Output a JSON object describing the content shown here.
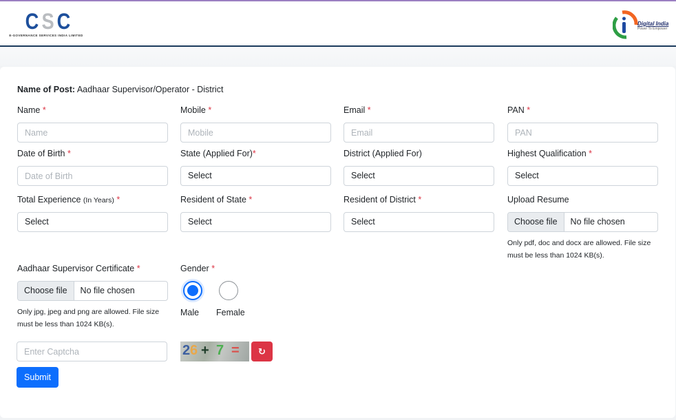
{
  "header": {
    "csc_logo": {
      "letters": [
        "C",
        "S",
        "C"
      ],
      "subtitle": "E-GOVERNANCE SERVICES INDIA LIMITED"
    },
    "digital_india_logo": {
      "title": "Digital India",
      "tagline": "Power To Empower"
    }
  },
  "form": {
    "post_label": "Name of Post:",
    "post_value": "Aadhaar Supervisor/Operator - District",
    "required_mark": "*",
    "fields": {
      "name": {
        "label": "Name",
        "placeholder": "Name"
      },
      "mobile": {
        "label": "Mobile",
        "placeholder": "Mobile"
      },
      "email": {
        "label": "Email",
        "placeholder": "Email"
      },
      "pan": {
        "label": "PAN",
        "placeholder": "PAN"
      },
      "dob": {
        "label": "Date of Birth",
        "placeholder": "Date of Birth"
      },
      "state_applied": {
        "label": "State (Applied For)",
        "value": "Select"
      },
      "district_applied": {
        "label": "District (Applied For)",
        "value": "Select"
      },
      "qualification": {
        "label": "Highest Qualification",
        "value": "Select"
      },
      "experience": {
        "label": "Total Experience",
        "label_note": "(In Years)",
        "value": "Select"
      },
      "resident_state": {
        "label": "Resident of State",
        "value": "Select"
      },
      "resident_district": {
        "label": "Resident of District",
        "value": "Select"
      },
      "resume": {
        "label": "Upload Resume",
        "button": "Choose file",
        "status": "No file chosen",
        "help_line1": "Only pdf, doc and docx are allowed. File size",
        "help_line2": "must be less than 1024 KB(s)."
      },
      "certificate": {
        "label": "Aadhaar Supervisor Certificate",
        "button": "Choose file",
        "status": "No file chosen",
        "help_line1": "Only jpg, jpeg and png are allowed. File size",
        "help_line2": "must be less than 1024 KB(s)."
      },
      "gender": {
        "label": "Gender",
        "options": [
          {
            "label": "Male",
            "checked": true
          },
          {
            "label": "Female",
            "checked": false
          }
        ]
      },
      "captcha": {
        "placeholder": "Enter Captcha",
        "image_text": "26 + 7 =",
        "refresh_icon": "↻"
      }
    },
    "submit_label": "Submit"
  },
  "colors": {
    "primary": "#0d6efd",
    "danger": "#dc3545",
    "csc_blue": "#1d4f9c",
    "header_border": "#1b3a5c"
  }
}
